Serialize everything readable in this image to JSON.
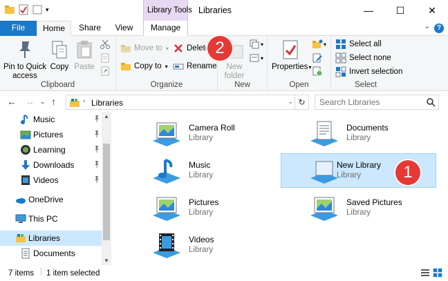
{
  "window": {
    "title": "Libraries",
    "context_tab_group": "Library Tools"
  },
  "tabs": {
    "file": "File",
    "home": "Home",
    "share": "Share",
    "view": "View",
    "manage": "Manage"
  },
  "ribbon": {
    "clipboard": {
      "label": "Clipboard",
      "pin": "Pin to Quick access",
      "copy": "Copy",
      "paste": "Paste"
    },
    "organize": {
      "label": "Organize",
      "move_to": "Move to",
      "copy_to": "Copy to",
      "delete": "Delete",
      "rename": "Rename"
    },
    "new": {
      "label": "New",
      "new_folder": "New folder"
    },
    "open": {
      "label": "Open",
      "properties": "Properties"
    },
    "select": {
      "label": "Select",
      "select_all": "Select all",
      "select_none": "Select none",
      "invert": "Invert selection"
    }
  },
  "address": {
    "crumb": "Libraries",
    "search_placeholder": "Search Libraries"
  },
  "nav": {
    "items": [
      {
        "label": "Music",
        "pinned": true
      },
      {
        "label": "Pictures",
        "pinned": true
      },
      {
        "label": "Learning",
        "pinned": true
      },
      {
        "label": "Downloads",
        "pinned": true
      },
      {
        "label": "Videos",
        "pinned": true
      },
      {
        "label": "OneDrive"
      },
      {
        "label": "This PC"
      },
      {
        "label": "Libraries",
        "selected": true
      },
      {
        "label": "Documents"
      }
    ]
  },
  "libraries": [
    {
      "name": "Camera Roll",
      "type": "Library"
    },
    {
      "name": "Documents",
      "type": "Library"
    },
    {
      "name": "Music",
      "type": "Library"
    },
    {
      "name": "New Library",
      "type": "Library",
      "selected": true
    },
    {
      "name": "Pictures",
      "type": "Library"
    },
    {
      "name": "Saved Pictures",
      "type": "Library"
    },
    {
      "name": "Videos",
      "type": "Library"
    }
  ],
  "status": {
    "count": "7 items",
    "selection": "1 item selected"
  },
  "callouts": {
    "one": "1",
    "two": "2"
  },
  "colors": {
    "accent": "#1979ca",
    "selection": "#cce8ff",
    "context_tab": "#e8d9f2",
    "callout": "#e53935"
  }
}
